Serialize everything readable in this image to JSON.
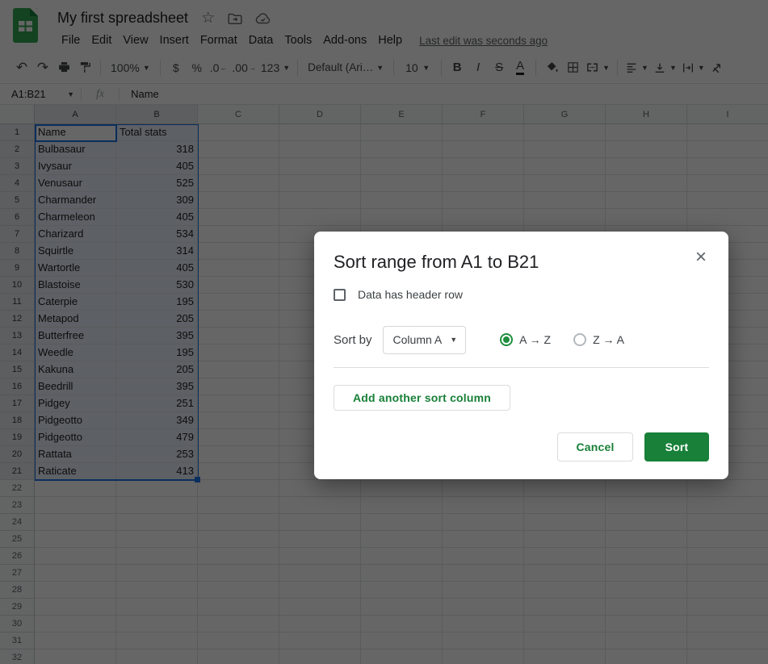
{
  "colors": {
    "accent_green": "#188038",
    "radio_green": "#1e8e3e",
    "selection_blue": "#1a73e8",
    "selection_fill": "#e9f1fc",
    "logo_green": "#34a853"
  },
  "titlebar": {
    "title": "My first spreadsheet",
    "icons": [
      "star-icon",
      "move-to-folder-icon",
      "cloud-saved-icon"
    ],
    "menus": [
      "File",
      "Edit",
      "View",
      "Insert",
      "Format",
      "Data",
      "Tools",
      "Add-ons",
      "Help"
    ],
    "last_edit": "Last edit was seconds ago"
  },
  "toolbar": {
    "zoom": "100%",
    "currency": "$",
    "percent": "%",
    "decrease_decimal": ".0",
    "increase_decimal": ".00",
    "more_formats": "123",
    "font_name": "Default (Ari…",
    "font_size": "10",
    "bold": "B",
    "italic": "I",
    "strikethrough": "S",
    "text_color": "A"
  },
  "formula_bar": {
    "name_box": "A1:B21",
    "fx_label": "fx",
    "value": "Name"
  },
  "sheet": {
    "columns": [
      "A",
      "B",
      "C",
      "D",
      "E",
      "F",
      "G",
      "H",
      "I"
    ],
    "row_count": 32,
    "selection": {
      "range": "A1:B21",
      "rows": 21,
      "cols": 2,
      "active_cell": "A1"
    },
    "data": [
      [
        "Name",
        "Total stats"
      ],
      [
        "Bulbasaur",
        "318"
      ],
      [
        "Ivysaur",
        "405"
      ],
      [
        "Venusaur",
        "525"
      ],
      [
        "Charmander",
        "309"
      ],
      [
        "Charmeleon",
        "405"
      ],
      [
        "Charizard",
        "534"
      ],
      [
        "Squirtle",
        "314"
      ],
      [
        "Wartortle",
        "405"
      ],
      [
        "Blastoise",
        "530"
      ],
      [
        "Caterpie",
        "195"
      ],
      [
        "Metapod",
        "205"
      ],
      [
        "Butterfree",
        "395"
      ],
      [
        "Weedle",
        "195"
      ],
      [
        "Kakuna",
        "205"
      ],
      [
        "Beedrill",
        "395"
      ],
      [
        "Pidgey",
        "251"
      ],
      [
        "Pidgeotto",
        "349"
      ],
      [
        "Pidgeotto",
        "479"
      ],
      [
        "Rattata",
        "253"
      ],
      [
        "Raticate",
        "413"
      ]
    ]
  },
  "dialog": {
    "title": "Sort range from A1 to B21",
    "close": "×",
    "header_checkbox_label": "Data has header row",
    "header_checkbox_checked": false,
    "sort_by_label": "Sort by",
    "column_select_value": "Column A",
    "radio_asc": "A → Z",
    "radio_desc": "Z → A",
    "selected_radio": "A → Z",
    "add_sort_column": "Add another sort column",
    "cancel": "Cancel",
    "sort": "Sort"
  }
}
